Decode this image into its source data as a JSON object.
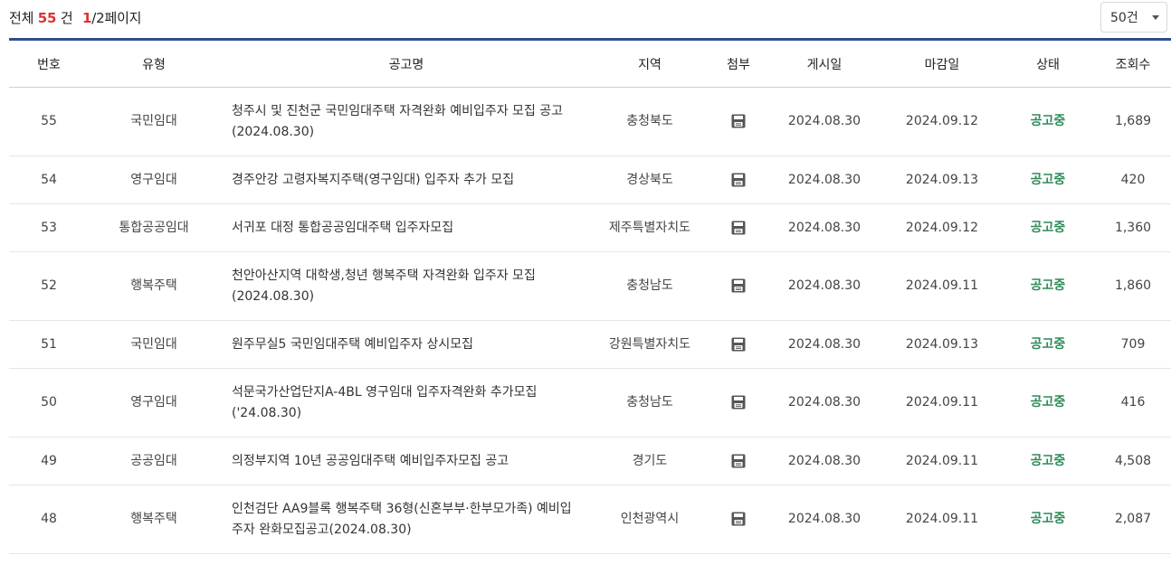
{
  "summary": {
    "prefix": "전체",
    "count": "55",
    "unit": "건",
    "page_current": "1",
    "page_rest": "/2페이지"
  },
  "perpage": {
    "selected": "50건"
  },
  "columns": [
    "번호",
    "유형",
    "공고명",
    "지역",
    "첨부",
    "게시일",
    "마감일",
    "상태",
    "조회수"
  ],
  "rows": [
    {
      "no": "55",
      "type": "국민임대",
      "title": "청주시 및 진천군 국민임대주택 자격완화 예비입주자 모집 공고 (2024.08.30)",
      "region": "충청북도",
      "posted": "2024.08.30",
      "deadline": "2024.09.12",
      "status": "공고중",
      "views": "1,689"
    },
    {
      "no": "54",
      "type": "영구임대",
      "title": "경주안강 고령자복지주택(영구임대) 입주자 추가 모집",
      "region": "경상북도",
      "posted": "2024.08.30",
      "deadline": "2024.09.13",
      "status": "공고중",
      "views": "420"
    },
    {
      "no": "53",
      "type": "통합공공임대",
      "title": "서귀포 대정 통합공공임대주택 입주자모집",
      "region": "제주특별자치도",
      "posted": "2024.08.30",
      "deadline": "2024.09.12",
      "status": "공고중",
      "views": "1,360"
    },
    {
      "no": "52",
      "type": "행복주택",
      "title": "천안아산지역 대학생,청년 행복주택 자격완화 입주자 모집 (2024.08.30)",
      "region": "충청남도",
      "posted": "2024.08.30",
      "deadline": "2024.09.11",
      "status": "공고중",
      "views": "1,860"
    },
    {
      "no": "51",
      "type": "국민임대",
      "title": "원주무실5 국민임대주택 예비입주자 상시모집",
      "region": "강원특별자치도",
      "posted": "2024.08.30",
      "deadline": "2024.09.13",
      "status": "공고중",
      "views": "709"
    },
    {
      "no": "50",
      "type": "영구임대",
      "title": "석문국가산업단지A-4BL 영구임대 입주자격완화 추가모집 ('24.08.30)",
      "region": "충청남도",
      "posted": "2024.08.30",
      "deadline": "2024.09.11",
      "status": "공고중",
      "views": "416"
    },
    {
      "no": "49",
      "type": "공공임대",
      "title": "의정부지역 10년 공공임대주택 예비입주자모집 공고",
      "region": "경기도",
      "posted": "2024.08.30",
      "deadline": "2024.09.11",
      "status": "공고중",
      "views": "4,508"
    },
    {
      "no": "48",
      "type": "행복주택",
      "title": "인천검단 AA9블록 행복주택 36형(신혼부부·한부모가족) 예비입주자 완화모집공고(2024.08.30)",
      "region": "인천광역시",
      "posted": "2024.08.30",
      "deadline": "2024.09.11",
      "status": "공고중",
      "views": "2,087"
    }
  ],
  "icons": {
    "attachment": "floppy-disk-icon",
    "dropdown": "caret-down-icon"
  },
  "colors": {
    "header_border": "#2e4f8e",
    "status": "#2e8b57",
    "count_highlight": "#e03030"
  }
}
